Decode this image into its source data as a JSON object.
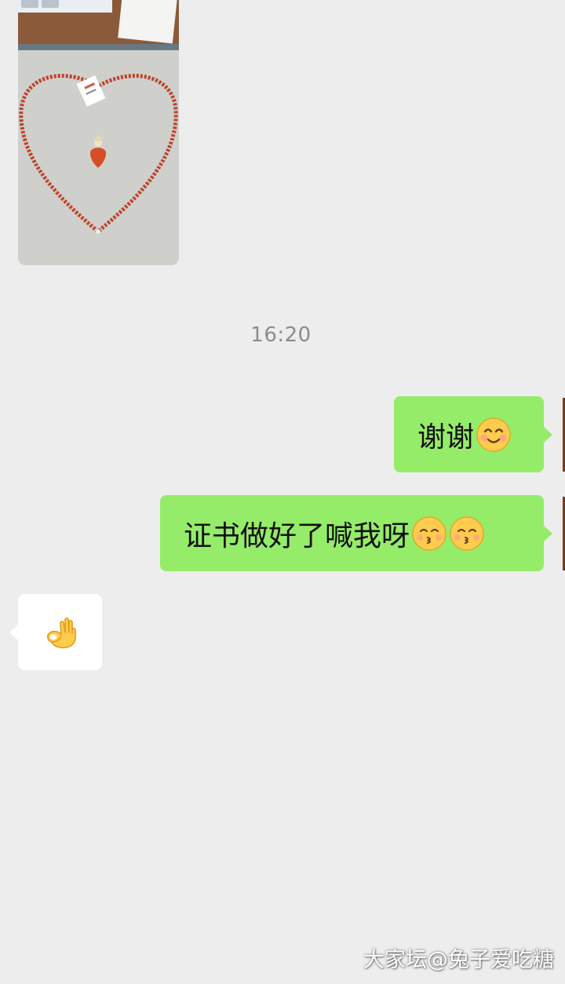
{
  "chat": {
    "photo_message": {
      "sender": "them",
      "icon": "photo-icon"
    },
    "timestamp": "16:20",
    "messages": [
      {
        "sender": "me",
        "text": "谢谢",
        "emojis": [
          "smiling-face-icon"
        ]
      },
      {
        "sender": "me",
        "text": "证书做好了喊我呀",
        "emojis": [
          "kissing-face-icon",
          "kissing-face-icon"
        ]
      },
      {
        "sender": "them",
        "text": "",
        "emojis": [
          "ok-hand-icon"
        ]
      }
    ]
  },
  "watermark": "大家坛@兔子爱吃糖",
  "colors": {
    "background": "#ededed",
    "outgoing_bubble": "#95ec69",
    "incoming_bubble": "#ffffff",
    "timestamp": "#8c8c8c"
  }
}
